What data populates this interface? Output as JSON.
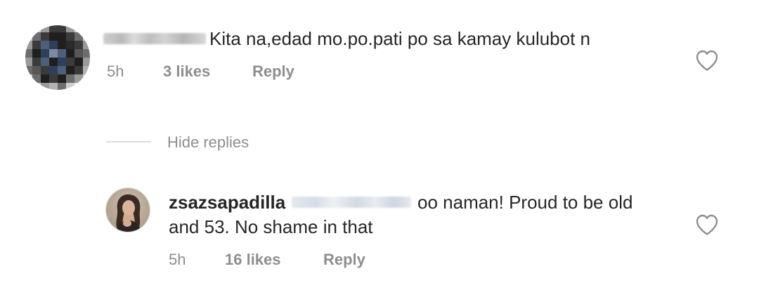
{
  "comments": [
    {
      "text": "Kita na,edad mo.po.pati po sa kamay kulubot n",
      "time": "5h",
      "likes": "3 likes",
      "reply_label": "Reply"
    }
  ],
  "replies_toggle": {
    "label": "Hide replies"
  },
  "reply_comment": {
    "username": "zsazsapadilla",
    "text_line1": "oo naman! Proud to be old",
    "text_line2": "and 53. No shame in that",
    "time": "5h",
    "likes": "16 likes",
    "reply_label": "Reply"
  },
  "icons": {
    "like": "heart-outline-icon"
  },
  "colors": {
    "text_primary": "#262626",
    "text_secondary": "#8e8e8e",
    "divider": "#dbdbdb"
  }
}
